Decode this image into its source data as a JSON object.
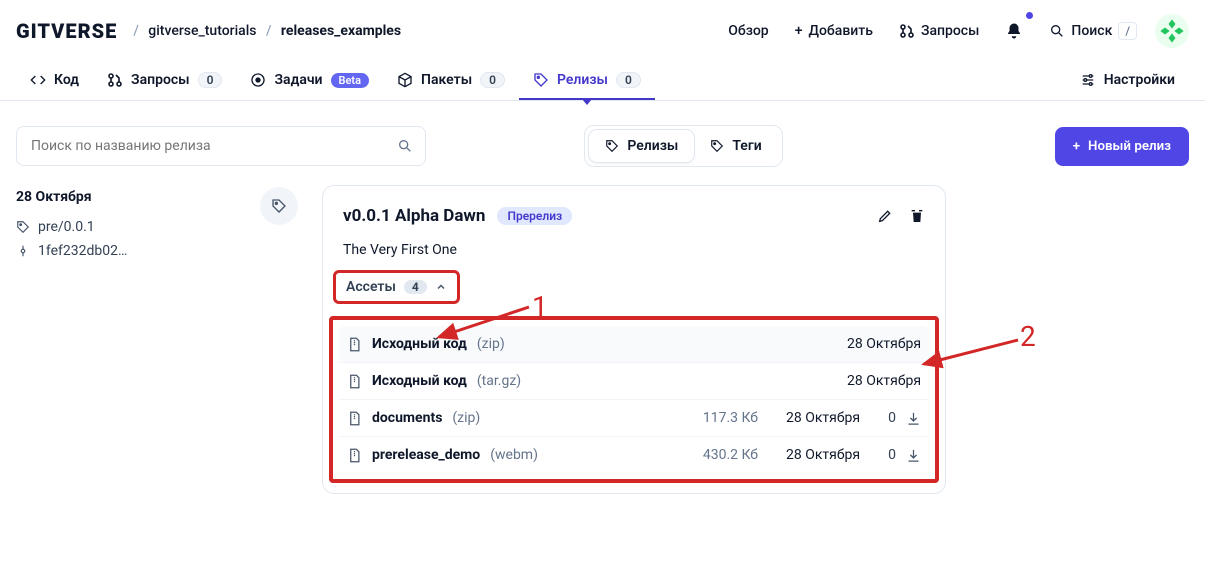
{
  "header": {
    "logo": "GITVERSE",
    "breadcrumb": {
      "owner": "gitverse_tutorials",
      "repo": "releases_examples"
    },
    "overview": "Обзор",
    "add": "Добавить",
    "requests": "Запросы",
    "search": "Поиск",
    "search_key": "/"
  },
  "nav": {
    "code": "Код",
    "requests": {
      "label": "Запросы",
      "count": "0"
    },
    "issues": {
      "label": "Задачи",
      "beta": "Beta"
    },
    "packages": {
      "label": "Пакеты",
      "count": "0"
    },
    "releases": {
      "label": "Релизы",
      "count": "0"
    },
    "settings": "Настройки"
  },
  "controls": {
    "search_placeholder": "Поиск по названию релиза",
    "toggle": {
      "releases": "Релизы",
      "tags": "Теги"
    },
    "new_release": "Новый релиз"
  },
  "sidebar": {
    "date": "28 Октября",
    "tag": "pre/0.0.1",
    "commit": "1fef232db02…"
  },
  "release": {
    "title": "v0.0.1 Alpha Dawn",
    "prerelease_badge": "Пререлиз",
    "description": "The Very First One",
    "assets": {
      "label": "Ассеты",
      "count": "4"
    },
    "rows": [
      {
        "name": "Исходный код",
        "ext": "(zip)",
        "size": "",
        "date": "28 Октября",
        "downloads": "",
        "has_dl": false
      },
      {
        "name": "Исходный код",
        "ext": "(tar.gz)",
        "size": "",
        "date": "28 Октября",
        "downloads": "",
        "has_dl": false
      },
      {
        "name": "documents",
        "ext": "(zip)",
        "size": "117.3 Кб",
        "date": "28 Октября",
        "downloads": "0",
        "has_dl": true
      },
      {
        "name": "prerelease_demo",
        "ext": "(webm)",
        "size": "430.2 Кб",
        "date": "28 Октября",
        "downloads": "0",
        "has_dl": true
      }
    ]
  },
  "annotations": {
    "one": "1",
    "two": "2"
  }
}
